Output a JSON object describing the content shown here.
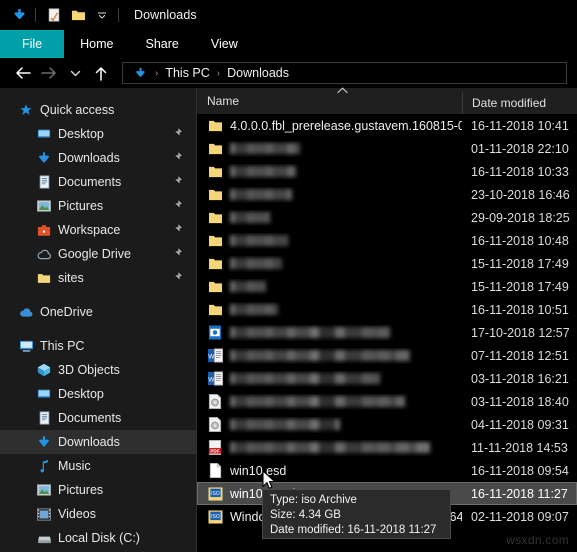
{
  "window": {
    "title": "Downloads",
    "quick_access_icons": [
      "download-icon",
      "properties-icon",
      "new-folder-icon",
      "customize-dropdown-icon"
    ]
  },
  "ribbon": {
    "tabs": [
      {
        "label": "File",
        "active": true,
        "color": "#00a0a8"
      },
      {
        "label": "Home",
        "active": false
      },
      {
        "label": "Share",
        "active": false
      },
      {
        "label": "View",
        "active": false
      }
    ]
  },
  "address_bar": {
    "back_icon": "back-arrow-icon",
    "forward_icon": "forward-arrow-icon",
    "recent_icon": "chevron-down-icon",
    "up_icon": "up-arrow-icon",
    "crumbs": [
      "This PC",
      "Downloads"
    ],
    "crumb_icon": "downloads-arrow-icon",
    "separator": "›"
  },
  "sidebar": {
    "groups": [
      {
        "header": {
          "label": "Quick access",
          "icon": "star-icon"
        },
        "items": [
          {
            "label": "Desktop",
            "icon": "desktop-icon",
            "pinned": true
          },
          {
            "label": "Downloads",
            "icon": "downloads-arrow-icon",
            "pinned": true
          },
          {
            "label": "Documents",
            "icon": "documents-icon",
            "pinned": true
          },
          {
            "label": "Pictures",
            "icon": "pictures-icon",
            "pinned": true
          },
          {
            "label": "Workspace",
            "icon": "briefcase-icon",
            "pinned": true
          },
          {
            "label": "Google Drive",
            "icon": "cloud-icon",
            "pinned": true
          },
          {
            "label": "sites",
            "icon": "folder-icon",
            "pinned": true
          }
        ]
      },
      {
        "header": {
          "label": "OneDrive",
          "icon": "onedrive-cloud-icon"
        },
        "items": []
      },
      {
        "header": {
          "label": "This PC",
          "icon": "this-pc-icon"
        },
        "items": [
          {
            "label": "3D Objects",
            "icon": "3d-objects-icon",
            "pinned": false
          },
          {
            "label": "Desktop",
            "icon": "desktop-icon",
            "pinned": false
          },
          {
            "label": "Documents",
            "icon": "documents-icon",
            "pinned": false
          },
          {
            "label": "Downloads",
            "icon": "downloads-arrow-icon",
            "pinned": false,
            "selected": true
          },
          {
            "label": "Music",
            "icon": "music-note-icon",
            "pinned": false
          },
          {
            "label": "Pictures",
            "icon": "pictures-icon",
            "pinned": false
          },
          {
            "label": "Videos",
            "icon": "videos-icon",
            "pinned": false
          },
          {
            "label": "Local Disk (C:)",
            "icon": "hard-drive-icon",
            "pinned": false
          }
        ]
      }
    ]
  },
  "file_list": {
    "columns": [
      {
        "key": "name",
        "label": "Name",
        "sorted": "ascending",
        "sort_icon": "chevron-up-icon"
      },
      {
        "key": "date",
        "label": "Date modified",
        "sorted": null
      }
    ],
    "rows": [
      {
        "name": "4.0.0.0.fbl_prerelease.gustavem.160815-0...",
        "redacted": false,
        "icon": "folder-icon",
        "date": "16-11-2018 10:41",
        "selected": false
      },
      {
        "name": "",
        "redacted": true,
        "redact_width": 70,
        "icon": "folder-icon",
        "date": "01-11-2018 22:10",
        "selected": false
      },
      {
        "name": "",
        "redacted": true,
        "redact_width": 66,
        "icon": "folder-icon",
        "date": "16-11-2018 10:33",
        "selected": false
      },
      {
        "name": "",
        "redacted": true,
        "redact_width": 62,
        "icon": "folder-icon",
        "date": "23-10-2018 16:46",
        "selected": false
      },
      {
        "name": "",
        "redacted": true,
        "redact_width": 40,
        "icon": "folder-icon",
        "date": "29-09-2018 18:25",
        "selected": false
      },
      {
        "name": "",
        "redacted": true,
        "redact_width": 58,
        "icon": "folder-icon",
        "date": "16-11-2018 10:48",
        "selected": false
      },
      {
        "name": "",
        "redacted": true,
        "redact_width": 52,
        "icon": "folder-icon",
        "date": "15-11-2018 17:49",
        "selected": false
      },
      {
        "name": "",
        "redacted": true,
        "redact_width": 36,
        "icon": "folder-icon",
        "date": "15-11-2018 17:49",
        "selected": false
      },
      {
        "name": "",
        "redacted": true,
        "redact_width": 48,
        "icon": "folder-icon",
        "date": "16-11-2018 10:51",
        "selected": false
      },
      {
        "name": "",
        "redacted": true,
        "redact_width": 160,
        "icon": "powerpoint-icon",
        "date": "17-10-2018 12:57",
        "selected": false
      },
      {
        "name": "",
        "redacted": true,
        "redact_width": 180,
        "icon": "word-icon",
        "date": "07-11-2018 12:51",
        "selected": false
      },
      {
        "name": "",
        "redacted": true,
        "redact_width": 150,
        "icon": "word-icon",
        "date": "03-11-2018 16:21",
        "selected": false
      },
      {
        "name": "",
        "redacted": true,
        "redact_width": 175,
        "icon": "disc-image-icon",
        "date": "03-11-2018 18:40",
        "selected": false
      },
      {
        "name": "",
        "redacted": true,
        "redact_width": 110,
        "icon": "disc-image-icon",
        "date": "04-11-2018 09:31",
        "selected": false
      },
      {
        "name": "",
        "redacted": true,
        "redact_width": 200,
        "icon": "pdf-icon",
        "date": "11-11-2018 14:53",
        "selected": false
      },
      {
        "name": "win10.esd",
        "redacted": false,
        "icon": "generic-file-icon",
        "date": "16-11-2018 09:54",
        "selected": false
      },
      {
        "name": "win10MTE.iso",
        "redacted": false,
        "icon": "iso-icon",
        "date": "16-11-2018 11:27",
        "selected": true
      },
      {
        "name": "Windows_10_Insider_Preview_Client_x64_e...",
        "redacted": false,
        "icon": "iso-icon",
        "date": "02-11-2018 09:07",
        "selected": false
      }
    ]
  },
  "tooltip": {
    "type_line": "Type: iso Archive",
    "size_line": "Size: 4.34 GB",
    "date_line": "Date modified: 16-11-2018 11:27"
  },
  "watermark": {
    "text": "wsxdn.com"
  },
  "colors": {
    "accent": "#00a0a8",
    "folder": "#f5d57a",
    "downloads_blue": "#2196e8",
    "selection": "#4a4a4a"
  }
}
